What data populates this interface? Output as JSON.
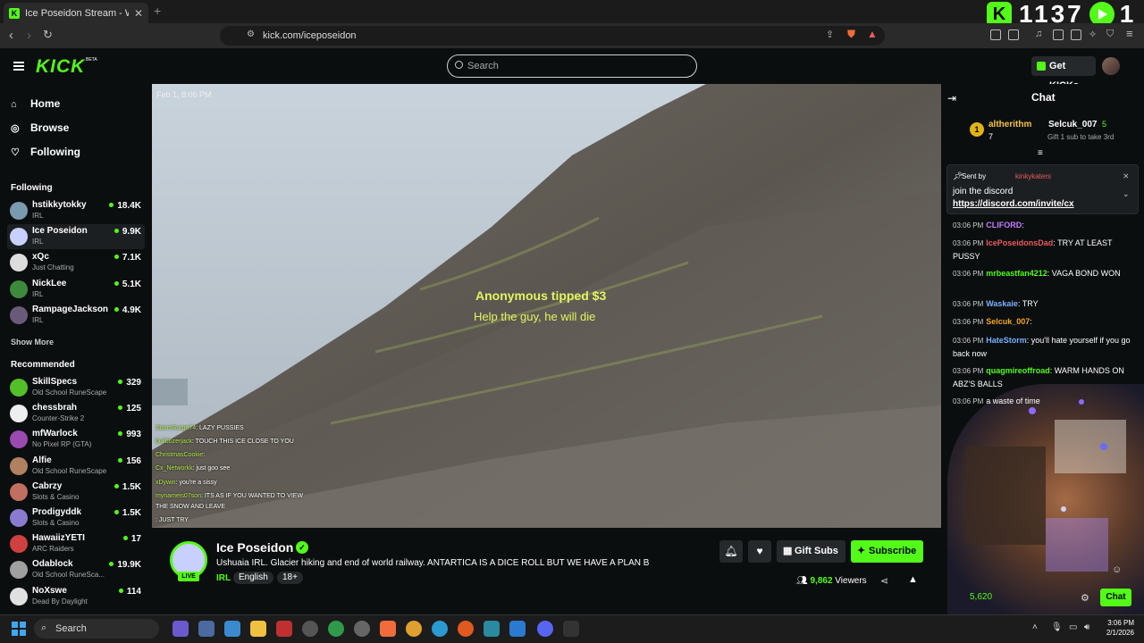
{
  "browser": {
    "tab_title": "Ice Poseidon Stream - Watch",
    "tab_close": "✕",
    "new_tab": "+",
    "url": "kick.com/iceposeidon",
    "overlay_counter": "1137",
    "overlay_counter2": "1"
  },
  "header": {
    "logo": "KICK",
    "beta": "BETA",
    "search_placeholder": "Search",
    "get_kicks": "Get KICKs"
  },
  "sidebar": {
    "nav": [
      {
        "label": "Home",
        "icon": "home-icon"
      },
      {
        "label": "Browse",
        "icon": "compass-icon"
      },
      {
        "label": "Following",
        "icon": "heart-icon"
      }
    ],
    "following_title": "Following",
    "following": [
      {
        "name": "hstikkytokky",
        "category": "IRL",
        "viewers": "18.4K",
        "color": "#7a9ab0"
      },
      {
        "name": "Ice Poseidon",
        "category": "IRL",
        "viewers": "9.9K",
        "color": "#c8d0ff"
      },
      {
        "name": "xQc",
        "category": "Just Chatting",
        "viewers": "7.1K",
        "color": "#dddddd"
      },
      {
        "name": "NickLee",
        "category": "IRL",
        "viewers": "5.1K",
        "color": "#3d8a3d"
      },
      {
        "name": "RampageJackson",
        "category": "IRL",
        "viewers": "4.9K",
        "color": "#6a5a7a"
      }
    ],
    "show_more": "Show More",
    "recommended_title": "Recommended",
    "recommended": [
      {
        "name": "SkillSpecs",
        "category": "Old School RuneScape",
        "viewers": "329",
        "color": "#53c02a"
      },
      {
        "name": "chessbrah",
        "category": "Counter-Strike 2",
        "viewers": "125",
        "color": "#eeeeee"
      },
      {
        "name": "mfWarlock",
        "category": "No Pixel RP (GTA)",
        "viewers": "993",
        "color": "#9a4ab0"
      },
      {
        "name": "Alfie",
        "category": "Old School RuneScape",
        "viewers": "156",
        "color": "#b08060"
      },
      {
        "name": "Cabrzy",
        "category": "Slots & Casino",
        "viewers": "1.5K",
        "color": "#c07060"
      },
      {
        "name": "Prodigyddk",
        "category": "Slots & Casino",
        "viewers": "1.5K",
        "color": "#8a7ad0"
      },
      {
        "name": "HawaiizYETI",
        "category": "ARC Raiders",
        "viewers": "17",
        "color": "#d04040"
      },
      {
        "name": "Odablock",
        "category": "Old School RuneSca...",
        "viewers": "19.9K",
        "color": "#a0a0a0"
      },
      {
        "name": "NoXswe",
        "category": "Dead By Daylight",
        "viewers": "114",
        "color": "#e0e0e0"
      }
    ]
  },
  "video": {
    "timestamp": "Feb 1, 8:06 PM",
    "tip_title": "Anonymous tipped $3",
    "tip_message": "Help the guy, he will die",
    "overlay_chat": [
      {
        "user": "StormSurge74",
        "msg": ": LAZY PUSSIES"
      },
      {
        "user": "bulldozerjack",
        "msg": ": TOUCH THIS ICE CLOSE TO YOU"
      },
      {
        "user": "ChristmasCookie",
        "msg": ":"
      },
      {
        "user": "Cx_Networkk",
        "msg": ": just goo see"
      },
      {
        "user": "xDywin",
        "msg": ": you're a sissy"
      },
      {
        "user": "mynameis07son",
        "msg": ": ITS AS IF YOU WANTED TO VIEW"
      },
      {
        "user": "",
        "msg": "THE SNOW AND LEAVE"
      },
      {
        "user": "",
        "msg": ": JUST TRY"
      }
    ]
  },
  "stream": {
    "name": "Ice Poseidon",
    "live": "LIVE",
    "title": "Ushuaia IRL. Glacier hiking and end of world railway. ANTARTICA IS A DICE ROLL BUT WE HAVE A PLAN B",
    "category": "IRL",
    "tags": [
      "English",
      "18+"
    ],
    "gift_subs": "Gift Subs",
    "subscribe": "Subscribe",
    "viewers_count": "9,862",
    "viewers_label": "Viewers"
  },
  "chat": {
    "title": "Chat",
    "leaderboard": [
      {
        "rank": "1",
        "name": "altherithm",
        "count": "7"
      },
      {
        "name": "Selcuk_007",
        "count": "5",
        "hint": "Gift 1 sub to take 3rd"
      }
    ],
    "pinned": {
      "sent_by": "Sent by",
      "user": "kinkykaters",
      "message": "join the discord",
      "link": "https://discord.com/invite/cx"
    },
    "messages": [
      {
        "time": "03:06 PM",
        "user": "CLIFORD",
        "color": "#c77dff",
        "msg": ":"
      },
      {
        "time": "03:06 PM",
        "user": "IcePoseidonsDad",
        "color": "#e85c5c",
        "msg": ": TRY AT LEAST PUSSY"
      },
      {
        "time": "03:06 PM",
        "user": "mrbeastfan4212",
        "color": "#53fc18",
        "msg": ": VAGA BOND WON"
      },
      {
        "time": "03:06 PM",
        "user": "Waskaie",
        "color": "#7ab0ff",
        "msg": ": TRY"
      },
      {
        "time": "03:06 PM",
        "user": "Selcuk_007",
        "color": "#f6a623",
        "msg": ":"
      },
      {
        "time": "03:06 PM",
        "user": "HateStorm",
        "color": "#7ab0ff",
        "msg": ": you'll hate yourself if you go back now"
      },
      {
        "time": "03:06 PM",
        "user": "quagmireoffroad",
        "color": "#53fc18",
        "msg": ": WARM HANDS ON ABZ'S BALLS"
      },
      {
        "time": "03:06 PM",
        "user": "",
        "color": "#ccc",
        "msg": "a waste of time"
      }
    ],
    "cam_count": "5,620",
    "chat_button": "Chat"
  },
  "taskbar": {
    "search": "Search",
    "time": "3:06 PM",
    "date": "2/1/2026"
  }
}
